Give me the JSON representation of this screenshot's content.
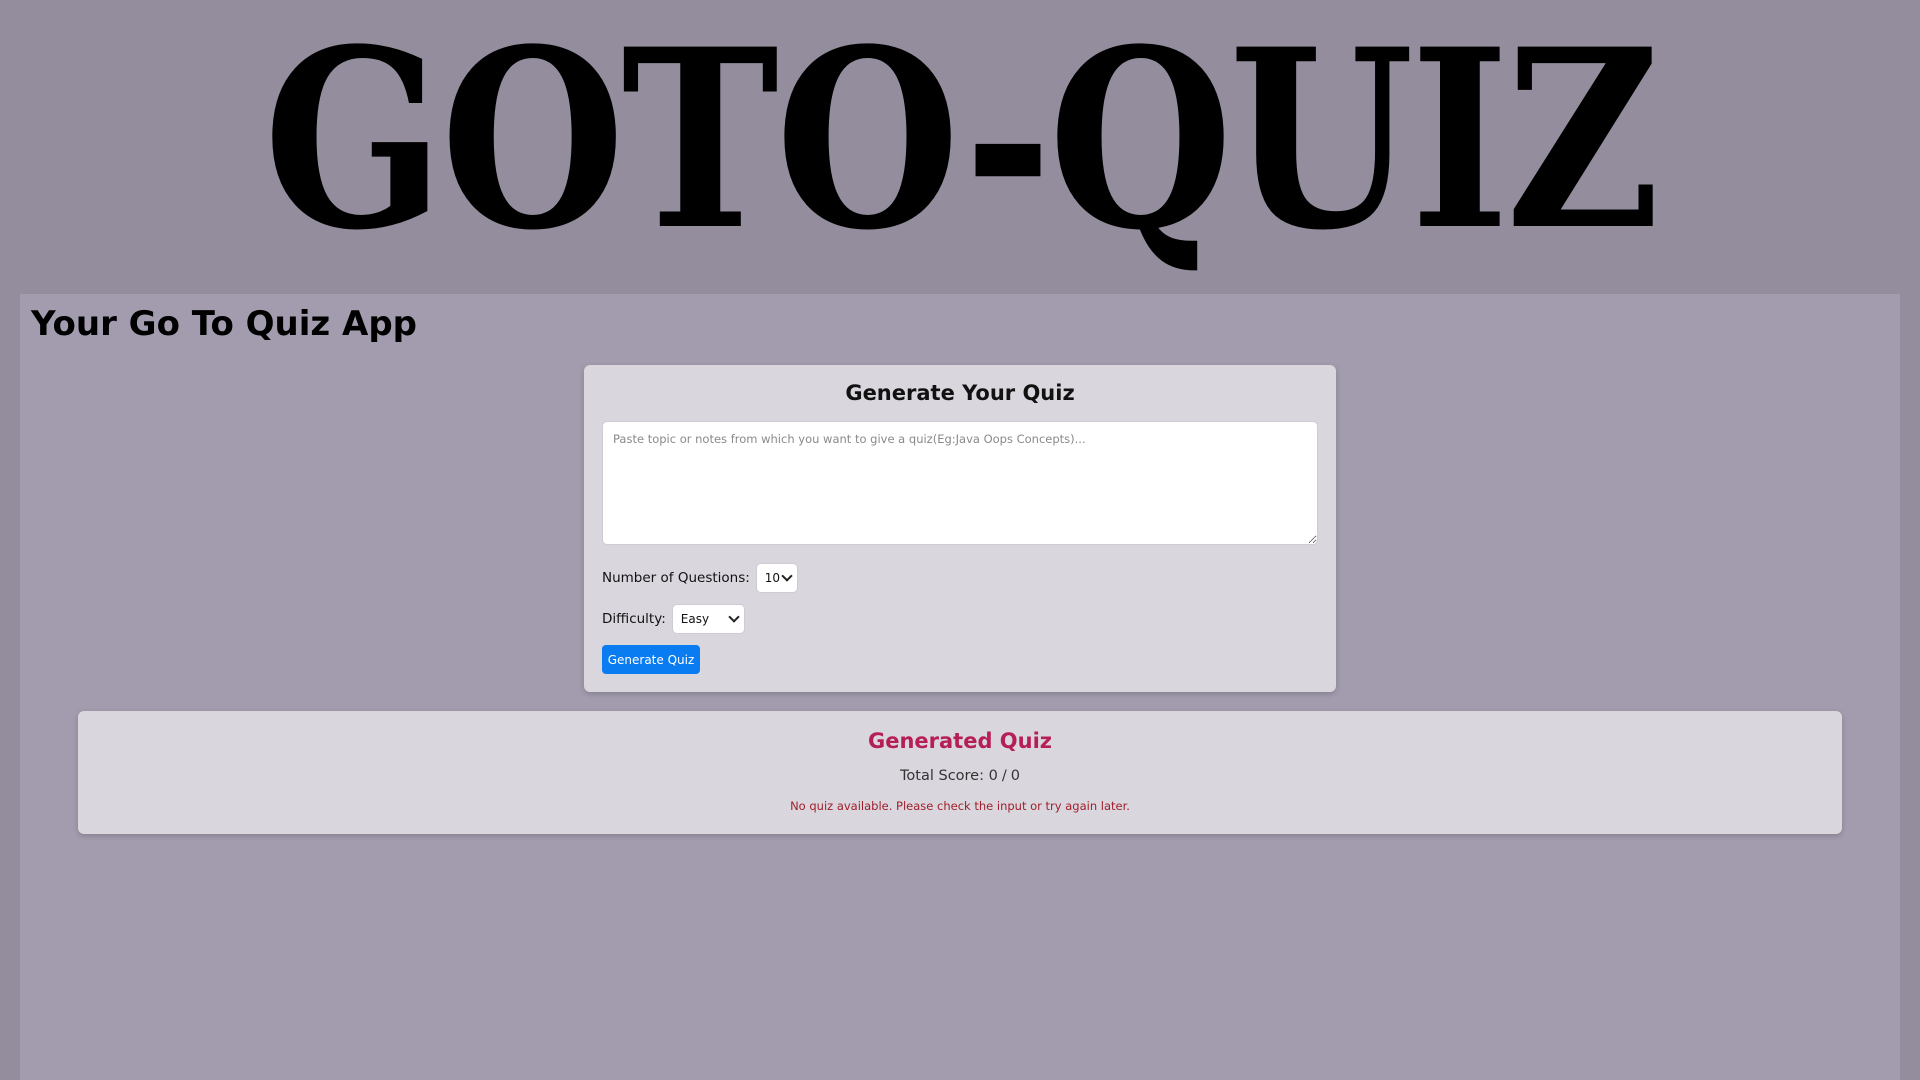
{
  "header": {
    "logo_text": "GOTO-QUIZ"
  },
  "app": {
    "title": "Your Go To Quiz App"
  },
  "form": {
    "title": "Generate Your Quiz",
    "topic_placeholder": "Paste topic or notes from which you want to give a quiz(Eg:Java Oops Concepts)...",
    "topic_value": "",
    "questions_label": "Number of Questions:",
    "questions_value": "10",
    "difficulty_label": "Difficulty:",
    "difficulty_value": "Easy",
    "generate_label": "Generate Quiz"
  },
  "result": {
    "title": "Generated Quiz",
    "score_label": "Total Score:",
    "score_value": "0",
    "score_separator": "/",
    "score_total": "0",
    "empty_message": "No quiz available. Please check the input or try again later."
  },
  "colors": {
    "page_background": "#938d9d",
    "panel_background": "#a29cae",
    "card_background": "#d9d6de",
    "primary_button": "#0a7cf2",
    "result_title": "#b51f55",
    "error_text": "#a11f2b"
  },
  "icons": {
    "select_arrow": "chevron-down-icon"
  }
}
